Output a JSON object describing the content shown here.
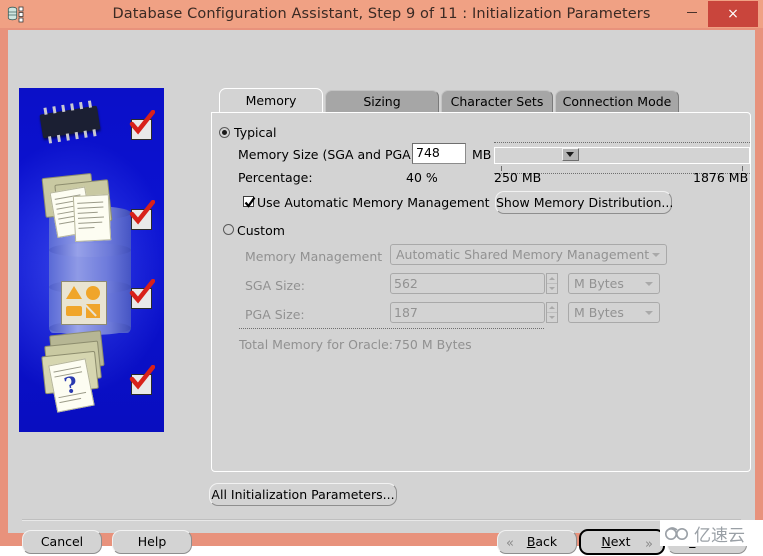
{
  "window": {
    "title": "Database Configuration Assistant, Step 9 of 11 : Initialization Parameters",
    "app_icon": "database-icon",
    "minimize_label": "Minimize",
    "maximize_label": "Maximize",
    "close_label": "×",
    "frame_color": "#f0a184",
    "close_color": "#c9453c",
    "client_color": "#d3d3d3"
  },
  "sidebar": {
    "graphic_name": "database-configuration-illustration",
    "background_color": "#0b10c8",
    "check_count": 4
  },
  "tabs": [
    {
      "label": "Memory",
      "active": true
    },
    {
      "label": "Sizing",
      "active": false
    },
    {
      "label": "Character Sets",
      "active": false
    },
    {
      "label": "Connection Mode",
      "active": false
    }
  ],
  "memory_tab": {
    "typical": {
      "radio_label": "Typical",
      "selected": true,
      "memory_size_label": "Memory Size (SGA and PGA):",
      "memory_size_value": "748",
      "memory_size_unit": "MB",
      "percentage_label": "Percentage:",
      "percentage_value": "40 %",
      "slider": {
        "min_label": "250 MB",
        "max_label": "1876 MB",
        "min": 250,
        "max": 1876,
        "value": 748
      },
      "auto_memory_checkbox_label": "Use Automatic Memory Management",
      "auto_memory_checked": true,
      "show_distribution_button": "Show Memory Distribution..."
    },
    "custom": {
      "radio_label": "Custom",
      "selected": false,
      "memory_management_label": "Memory Management",
      "memory_management_value": "Automatic Shared Memory Management",
      "sga_label": "SGA Size:",
      "sga_value": "562",
      "sga_unit": "M Bytes",
      "pga_label": "PGA Size:",
      "pga_value": "187",
      "pga_unit": "M Bytes",
      "total_label": "Total Memory for Oracle:",
      "total_value": "750 M Bytes"
    }
  },
  "all_params_button": "All Initialization Parameters...",
  "footer": {
    "cancel": "Cancel",
    "help": "Help",
    "back": "Back",
    "next": "Next",
    "finish": "Finish",
    "back_arrow": "«",
    "next_arrow": "»"
  },
  "watermark": {
    "text": "亿速云"
  }
}
